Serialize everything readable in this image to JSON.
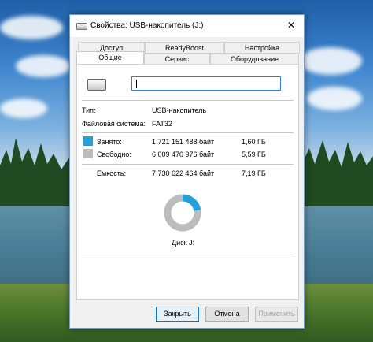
{
  "window": {
    "title": "Свойства: USB-накопитель (J:)",
    "close_glyph": "✕"
  },
  "tabs": {
    "back": [
      "Доступ",
      "ReadyBoost",
      "Настройка"
    ],
    "front": [
      "Общие",
      "Сервис",
      "Оборудование"
    ],
    "active": "Общие"
  },
  "general": {
    "name_value": "",
    "type_label": "Тип:",
    "type_value": "USB-накопитель",
    "fs_label": "Файловая система:",
    "fs_value": "FAT32",
    "used_label": "Занято:",
    "used_bytes": "1 721 151 488 байт",
    "used_size": "1,60 ГБ",
    "free_label": "Свободно:",
    "free_bytes": "6 009 470 976 байт",
    "free_size": "5,59 ГБ",
    "capacity_label": "Емкость:",
    "capacity_bytes": "7 730 622 464 байт",
    "capacity_size": "7,19 ГБ",
    "disk_label": "Диск J:",
    "used_fraction": 0.223,
    "colors": {
      "used": "#26a0da",
      "free": "#bcbcbc"
    }
  },
  "buttons": {
    "ok": "Закрыть",
    "cancel": "Отмена",
    "apply": "Применить"
  }
}
